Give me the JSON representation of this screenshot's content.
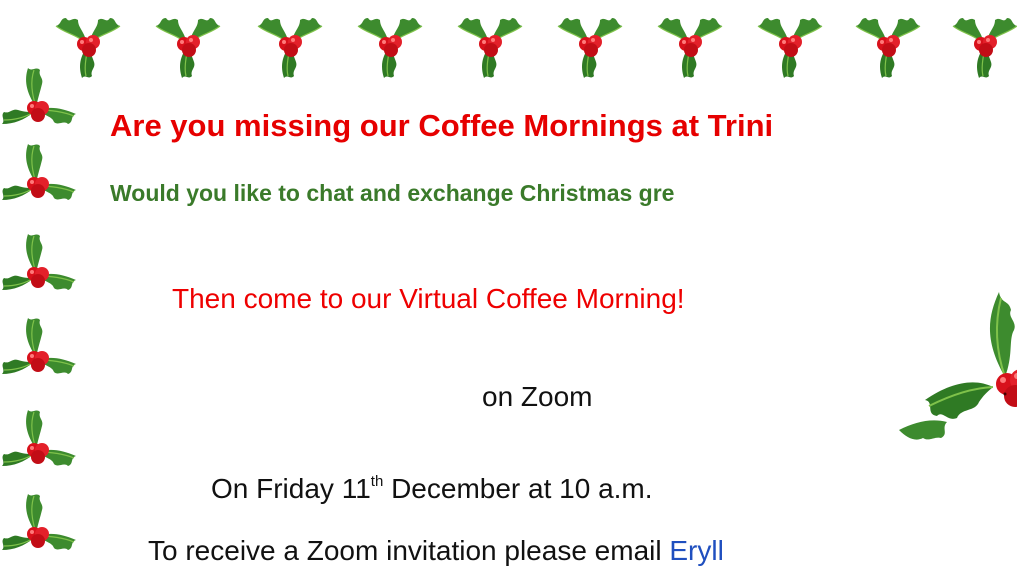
{
  "document": {
    "headline": "Are you missing our Coffee Mornings at Trini",
    "subheadline": "Would you like to chat and exchange Christmas gre",
    "invite": "Then come to our Virtual Coffee Morning!",
    "platform": "on Zoom",
    "date": {
      "prefix": "On Friday 11",
      "suffix": "th",
      "rest": " December at 10 a.m."
    },
    "contact": {
      "text": "To receive a Zoom invitation please email ",
      "link": "Eryll"
    }
  },
  "decoration": {
    "border_icon": "holly-icon",
    "leaf_color": "#3d8b2e",
    "leaf_light": "#7fc24a",
    "berry_color": "#d8111b"
  }
}
